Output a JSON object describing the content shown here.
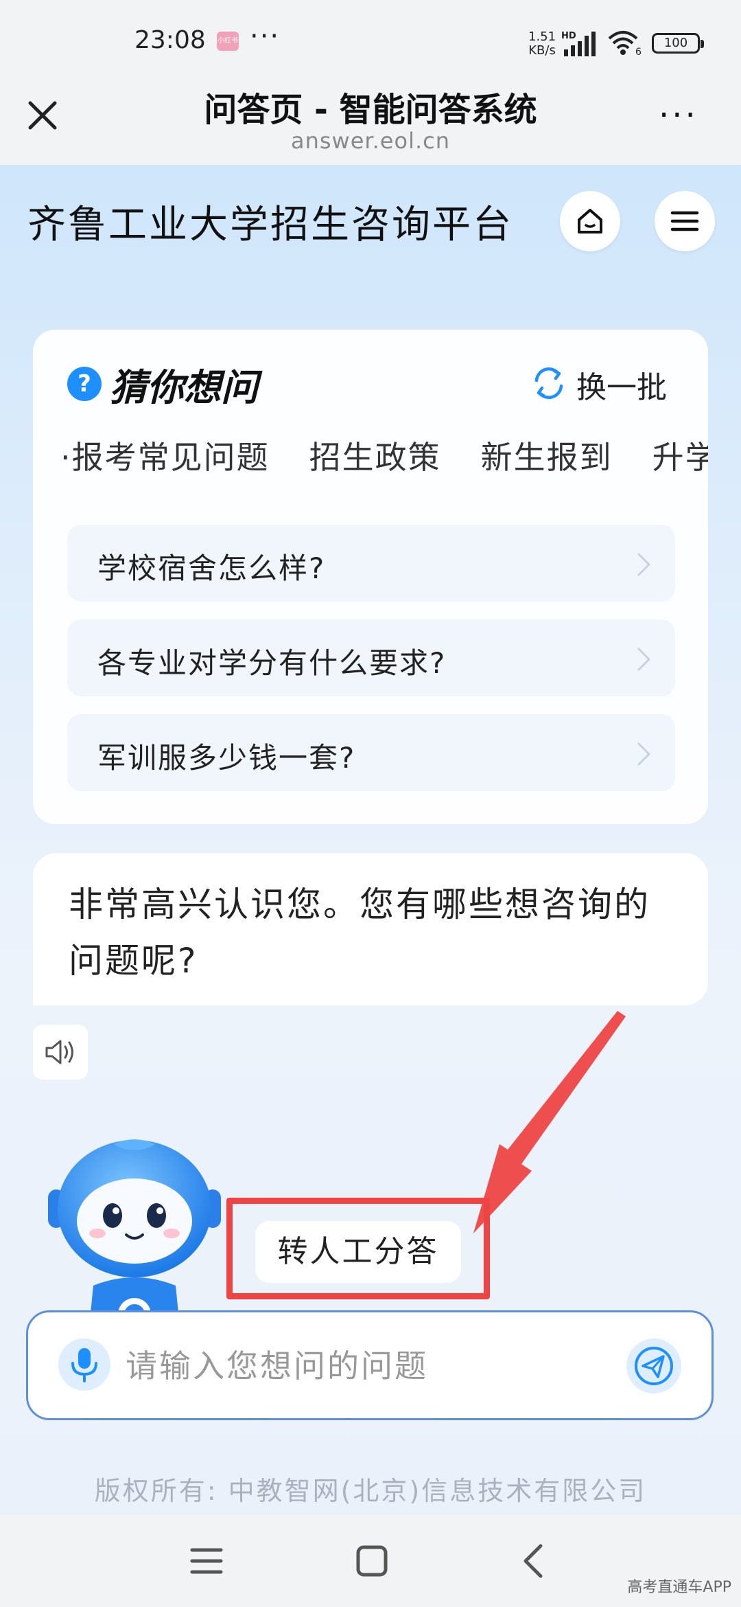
{
  "status_bar": {
    "time": "23:08",
    "app_badge": "小红书",
    "more": "···",
    "speed_value": "1.51",
    "speed_unit": "KB/s",
    "network": "HD",
    "wifi_label": "6",
    "battery": "100"
  },
  "browser": {
    "title": "问答页 - 智能问答系统",
    "url": "answer.eol.cn",
    "more": "···"
  },
  "header": {
    "site_title": "齐鲁工业大学招生咨询平台"
  },
  "guess_card": {
    "icon": "?",
    "title": "猜你想问",
    "refresh_label": "换一批",
    "tabs": [
      "·报考常见问题",
      "招生政策",
      "新生报到",
      "升学"
    ],
    "questions": [
      "学校宿舍怎么样?",
      "各专业对学分有什么要求?",
      "军训服多少钱一套?"
    ]
  },
  "chat": {
    "greeting": "非常高兴认识您。您有哪些想咨询的问题呢?"
  },
  "transfer": {
    "label": "转人工分答"
  },
  "input": {
    "placeholder": "请输入您想问的问题"
  },
  "footer": {
    "copyright": "版权所有: 中教智网(北京)信息技术有限公司"
  },
  "watermark": "高考直通车APP",
  "colors": {
    "accent": "#1e8fff",
    "highlight": "#ee4444",
    "input_border": "#5d8fe0"
  }
}
